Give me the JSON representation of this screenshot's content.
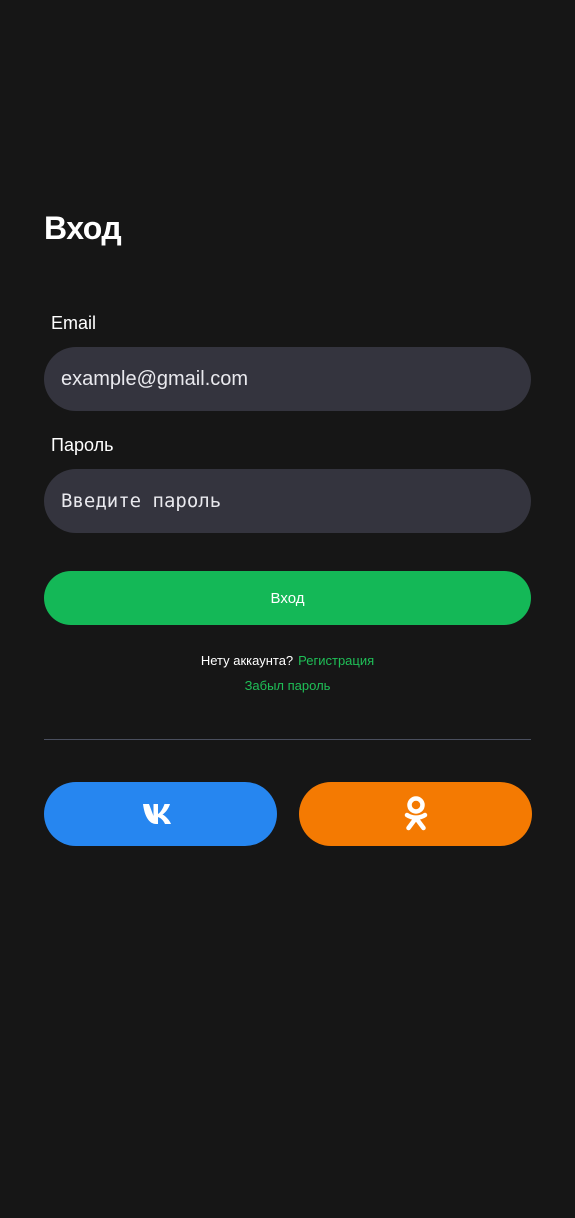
{
  "header": {
    "title": "Вход"
  },
  "form": {
    "email_label": "Email",
    "email_placeholder": "example@gmail.com",
    "password_label": "Пароль",
    "password_placeholder": "Введите пароль",
    "submit_label": "Вход"
  },
  "links": {
    "no_account_text": "Нету аккаунта?",
    "register_label": "Регистрация",
    "forgot_password_label": "Забыл пароль"
  },
  "social": {
    "vk": {
      "icon": "vk-logo-icon",
      "color": "#2686f0"
    },
    "ok": {
      "icon": "odnoklassniki-logo-icon",
      "color": "#f47a02"
    }
  },
  "colors": {
    "background": "#161616",
    "input_bg": "#34343e",
    "accent_green": "#14b857",
    "link_green": "#1fbf57",
    "divider": "#4a4f5e"
  }
}
